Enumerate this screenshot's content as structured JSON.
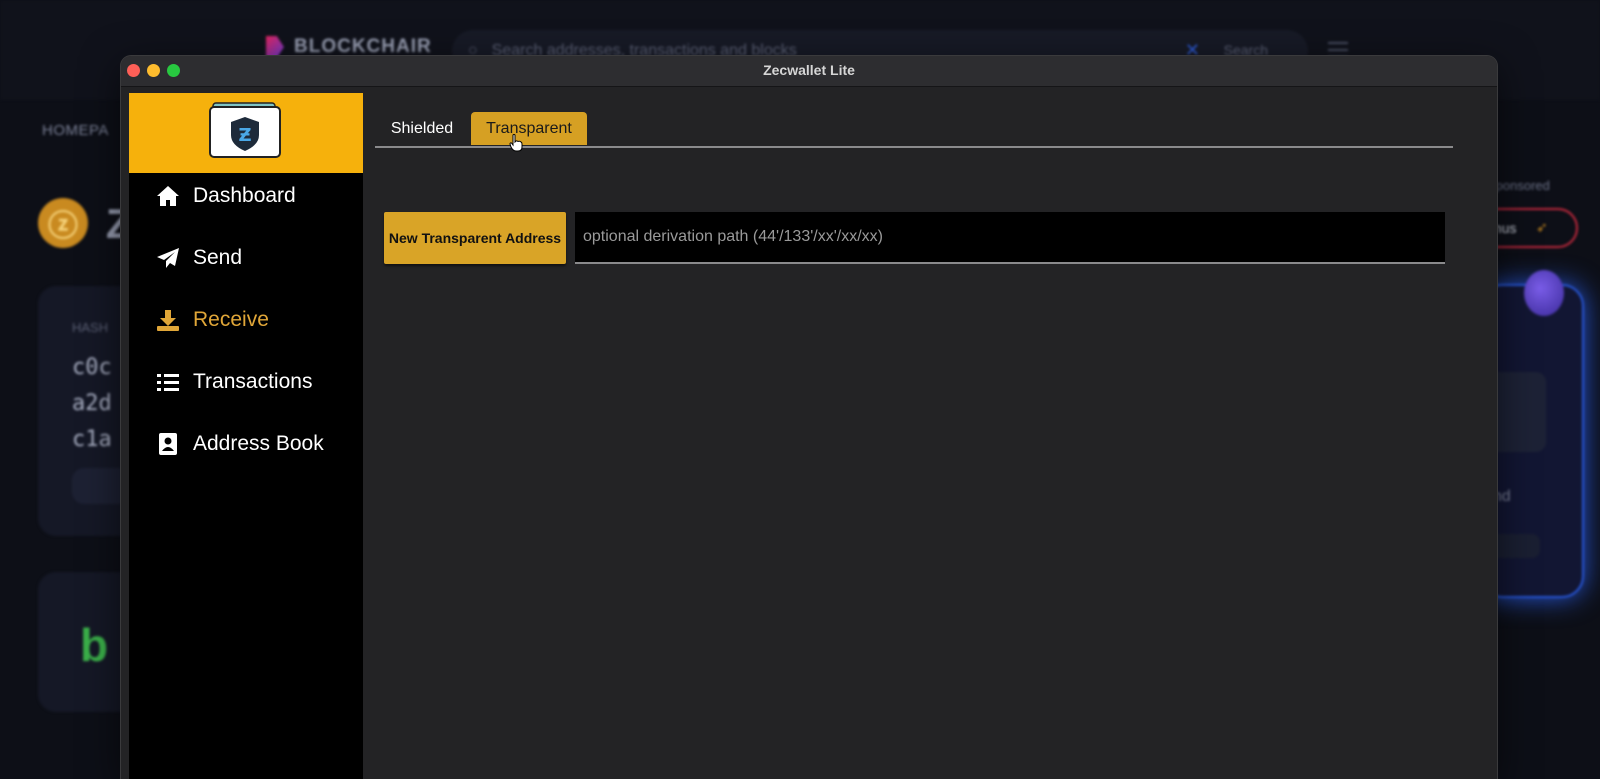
{
  "background": {
    "brand": "BLOCKCHAIR",
    "search_placeholder": "Search addresses, transactions and blocks",
    "search_button": "Search",
    "breadcrumb": "HOMEPA",
    "coin_symbol": "ⓩ",
    "coin_title": "Z",
    "hash_label": "HASH",
    "hash_lines": [
      "c0c",
      "a2d",
      "c1a"
    ],
    "sponsored": "| Sponsored",
    "bonus": "onus",
    "end_text": "end"
  },
  "window": {
    "title": "Zecwallet Lite"
  },
  "sidebar": {
    "items": [
      {
        "label": "Dashboard",
        "icon": "home-icon"
      },
      {
        "label": "Send",
        "icon": "paper-plane-icon"
      },
      {
        "label": "Receive",
        "icon": "download-icon"
      },
      {
        "label": "Transactions",
        "icon": "list-icon"
      },
      {
        "label": "Address Book",
        "icon": "contact-book-icon"
      }
    ],
    "active": "Receive",
    "active_color": "#e0a638"
  },
  "receive": {
    "tabs": [
      {
        "label": "Shielded"
      },
      {
        "label": "Transparent"
      }
    ],
    "active_tab": "Transparent",
    "new_address_button": "New Transparent Address",
    "derivation_path_placeholder": "optional derivation path (44'/133'/xx'/xx/xx)",
    "derivation_path_value": ""
  },
  "colors": {
    "accent": "#d9a427",
    "logo_bg": "#f6b10c"
  }
}
